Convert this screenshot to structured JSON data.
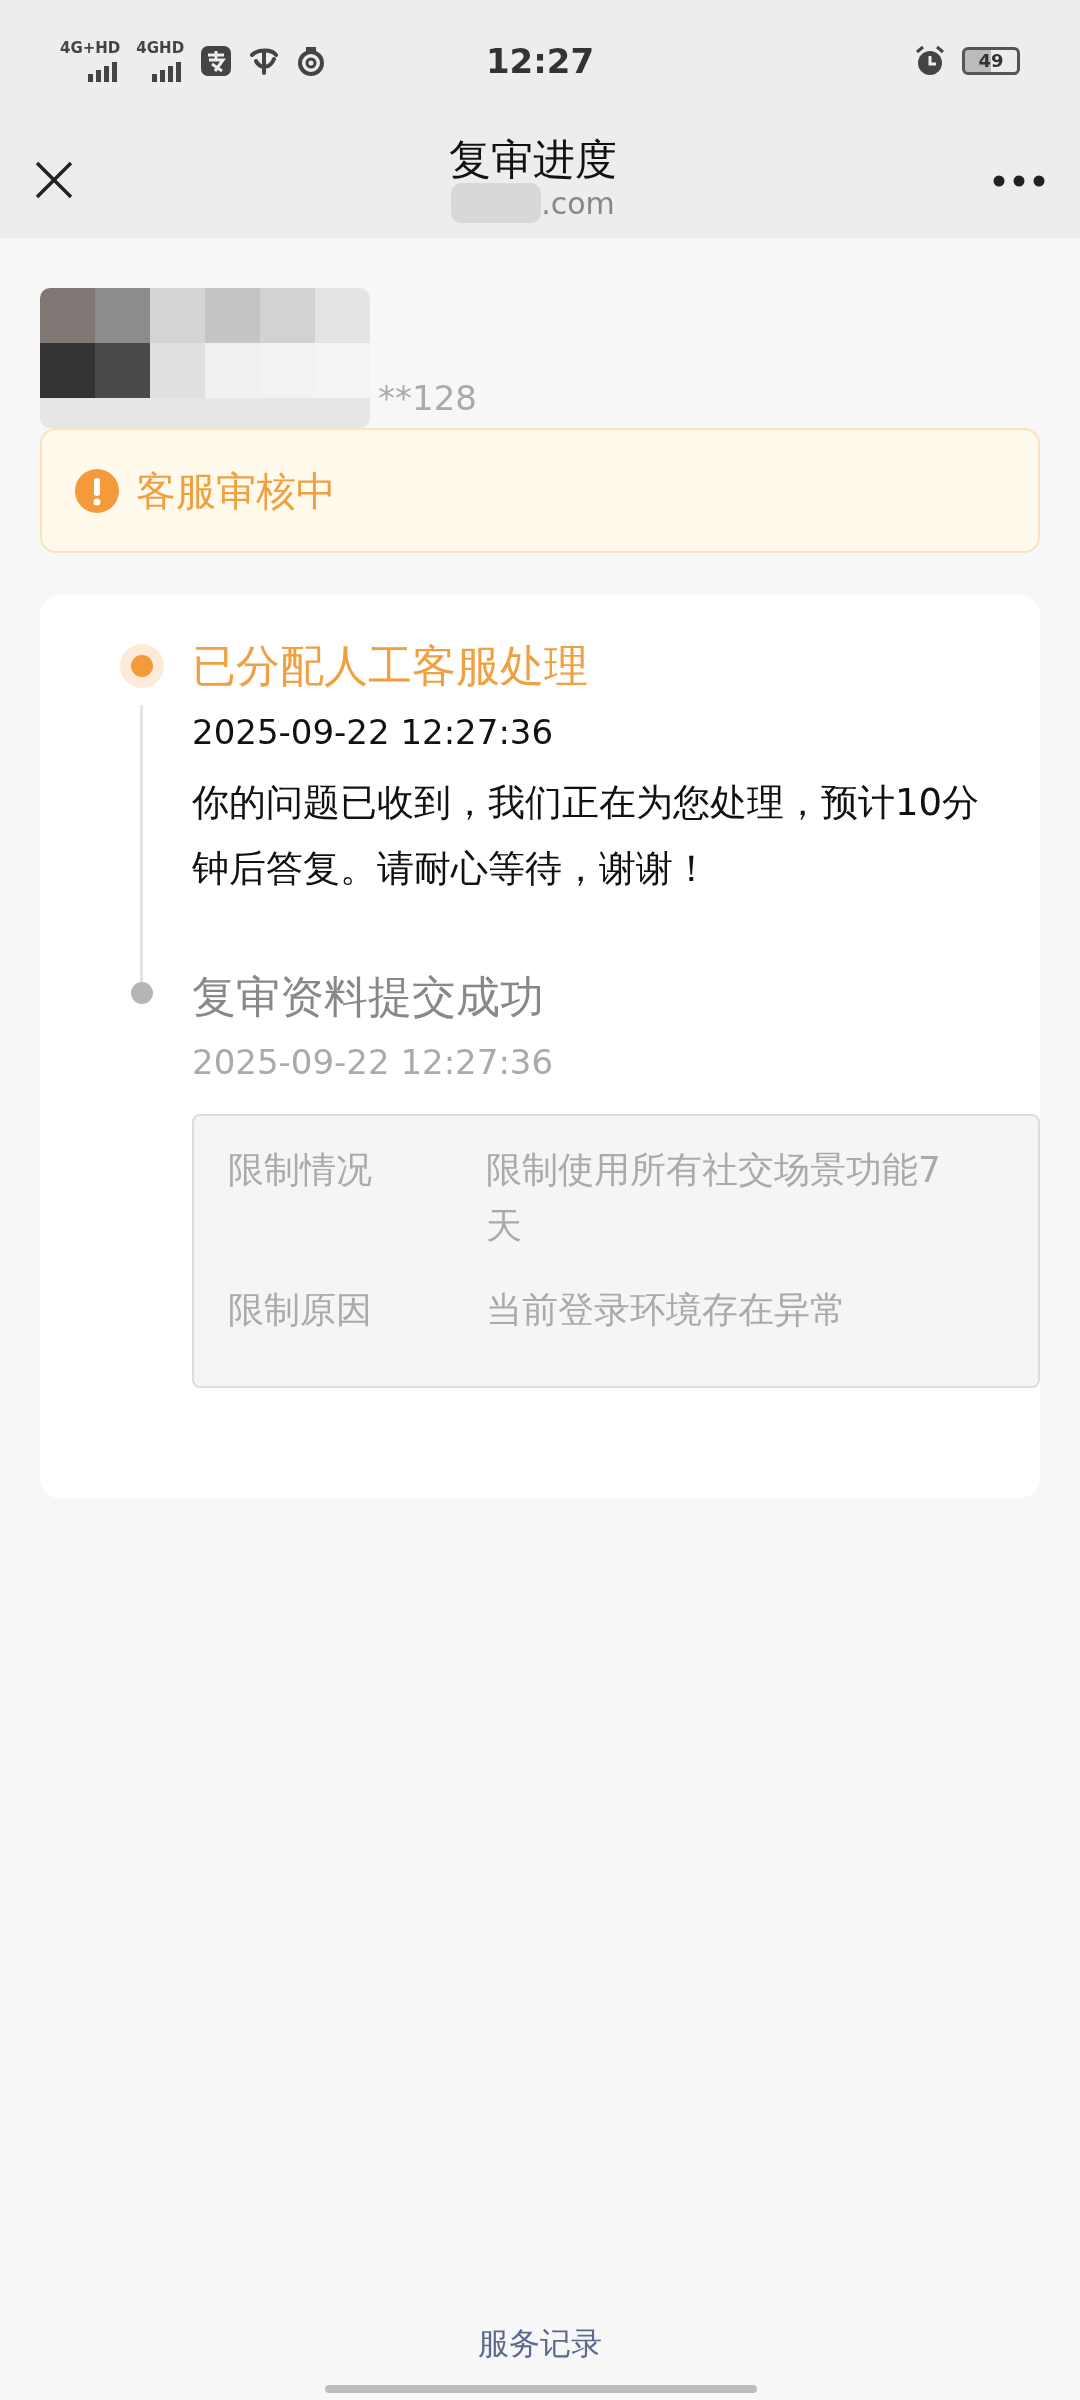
{
  "status_bar": {
    "network_1": "4G+HD",
    "network_2": "4GHD",
    "time": "12:27",
    "battery": "49"
  },
  "header": {
    "title": "复审进度",
    "subtitle": ".com"
  },
  "account": {
    "number": "**128"
  },
  "status_banner": {
    "text": "客服审核中"
  },
  "timeline": [
    {
      "title": "已分配人工客服处理",
      "time": "2025-09-22 12:27:36",
      "message": "你的问题已收到，我们正在为您处理，预计10分钟后答复。请耐心等待，谢谢！",
      "active": true
    },
    {
      "title": "复审资料提交成功",
      "time": "2025-09-22 12:27:36",
      "active": false,
      "details": [
        {
          "label": "限制情况",
          "value": "限制使用所有社交场景功能7天"
        },
        {
          "label": "限制原因",
          "value": "当前登录环境存在异常"
        }
      ]
    }
  ],
  "footer_link": "服务记录"
}
